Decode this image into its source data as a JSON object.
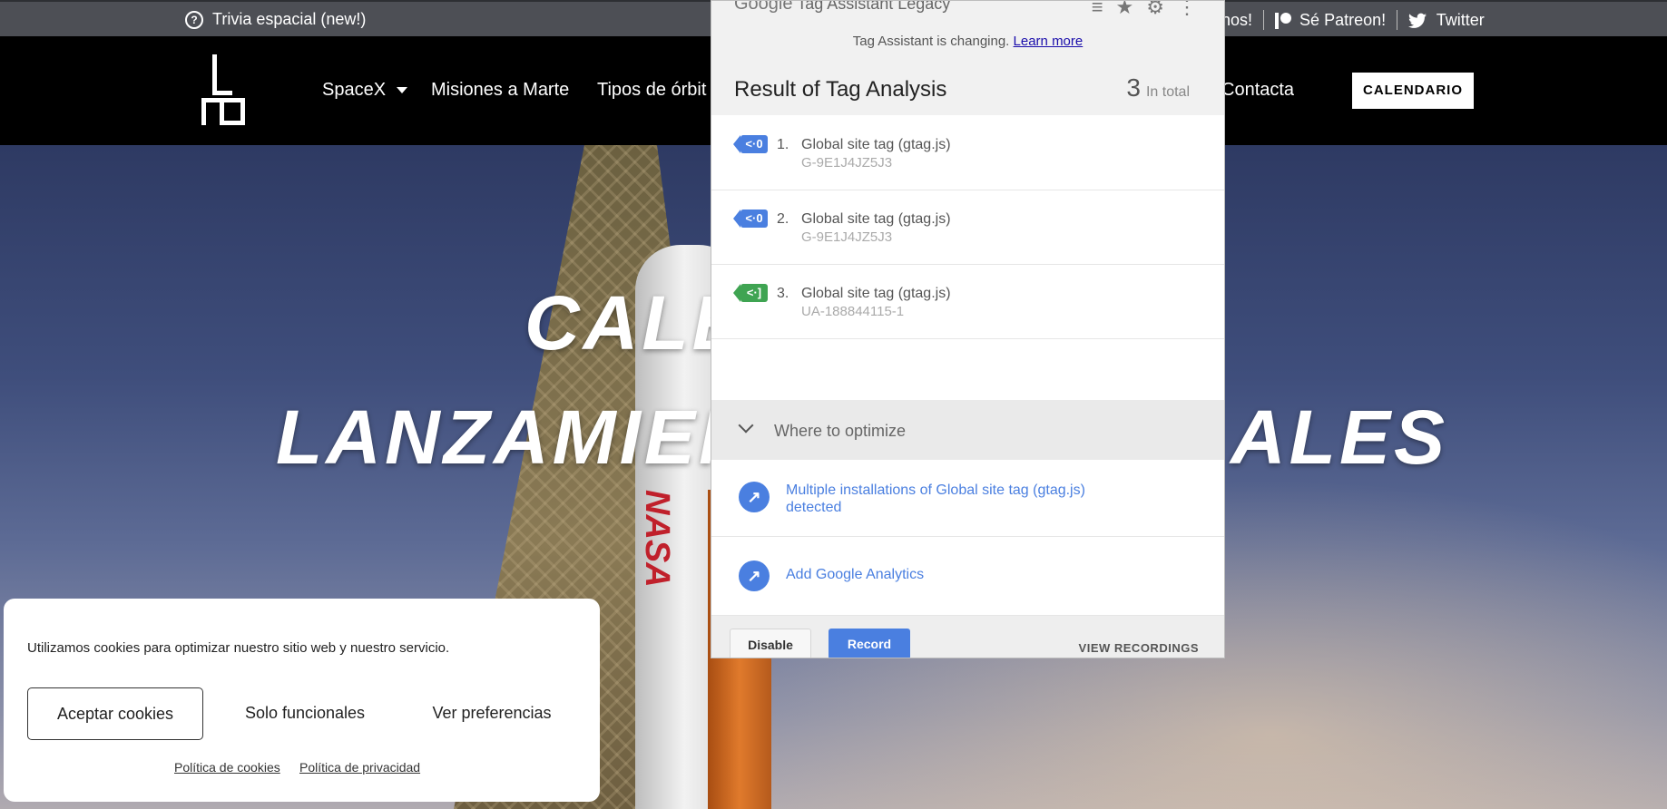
{
  "topbar": {
    "trivia_label": "Trivia espacial (new!)",
    "right_items": [
      "nos!",
      "Sé Patreon!",
      "Twitter"
    ]
  },
  "nav": {
    "items": [
      "SpaceX",
      "Misiones a Marte",
      "Tipos de órbit",
      "Contacta"
    ],
    "calendar_button": "CALENDARIO"
  },
  "hero": {
    "title_line1": "CALE",
    "title_line2_left": "LANZAMIEN",
    "title_line2_right": "ALES"
  },
  "tag_assistant": {
    "brand": "Google",
    "product": "Tag Assistant Legacy",
    "notice": "Tag Assistant is changing.",
    "learn_more": "Learn more",
    "result_title": "Result of Tag Analysis",
    "total_count": "3",
    "total_label": "In total",
    "tags": [
      {
        "num": "1.",
        "name": "Global site tag (gtag.js)",
        "id": "G-9E1J4JZ5J3",
        "color": "#4a7fe0"
      },
      {
        "num": "2.",
        "name": "Global site tag (gtag.js)",
        "id": "G-9E1J4JZ5J3",
        "color": "#4a7fe0"
      },
      {
        "num": "3.",
        "name": "Global site tag (gtag.js)",
        "id": "UA-188844115-1",
        "color": "#3fa452"
      }
    ],
    "optimize_header": "Where to optimize",
    "optimize_items": [
      {
        "line1": "Multiple installations of Global site tag (gtag.js)",
        "line2": "detected"
      },
      {
        "line1": "Add Google Analytics"
      }
    ],
    "disable_button": "Disable",
    "record_button": "Record",
    "view_recordings": "VIEW RECORDINGS"
  },
  "cookie_banner": {
    "message": "Utilizamos cookies para optimizar nuestro sitio web y nuestro servicio.",
    "accept_button": "Aceptar cookies",
    "functional_button": "Solo funcionales",
    "preferences_button": "Ver preferencias",
    "cookie_policy_link": "Política de cookies",
    "privacy_policy_link": "Política de privacidad"
  }
}
